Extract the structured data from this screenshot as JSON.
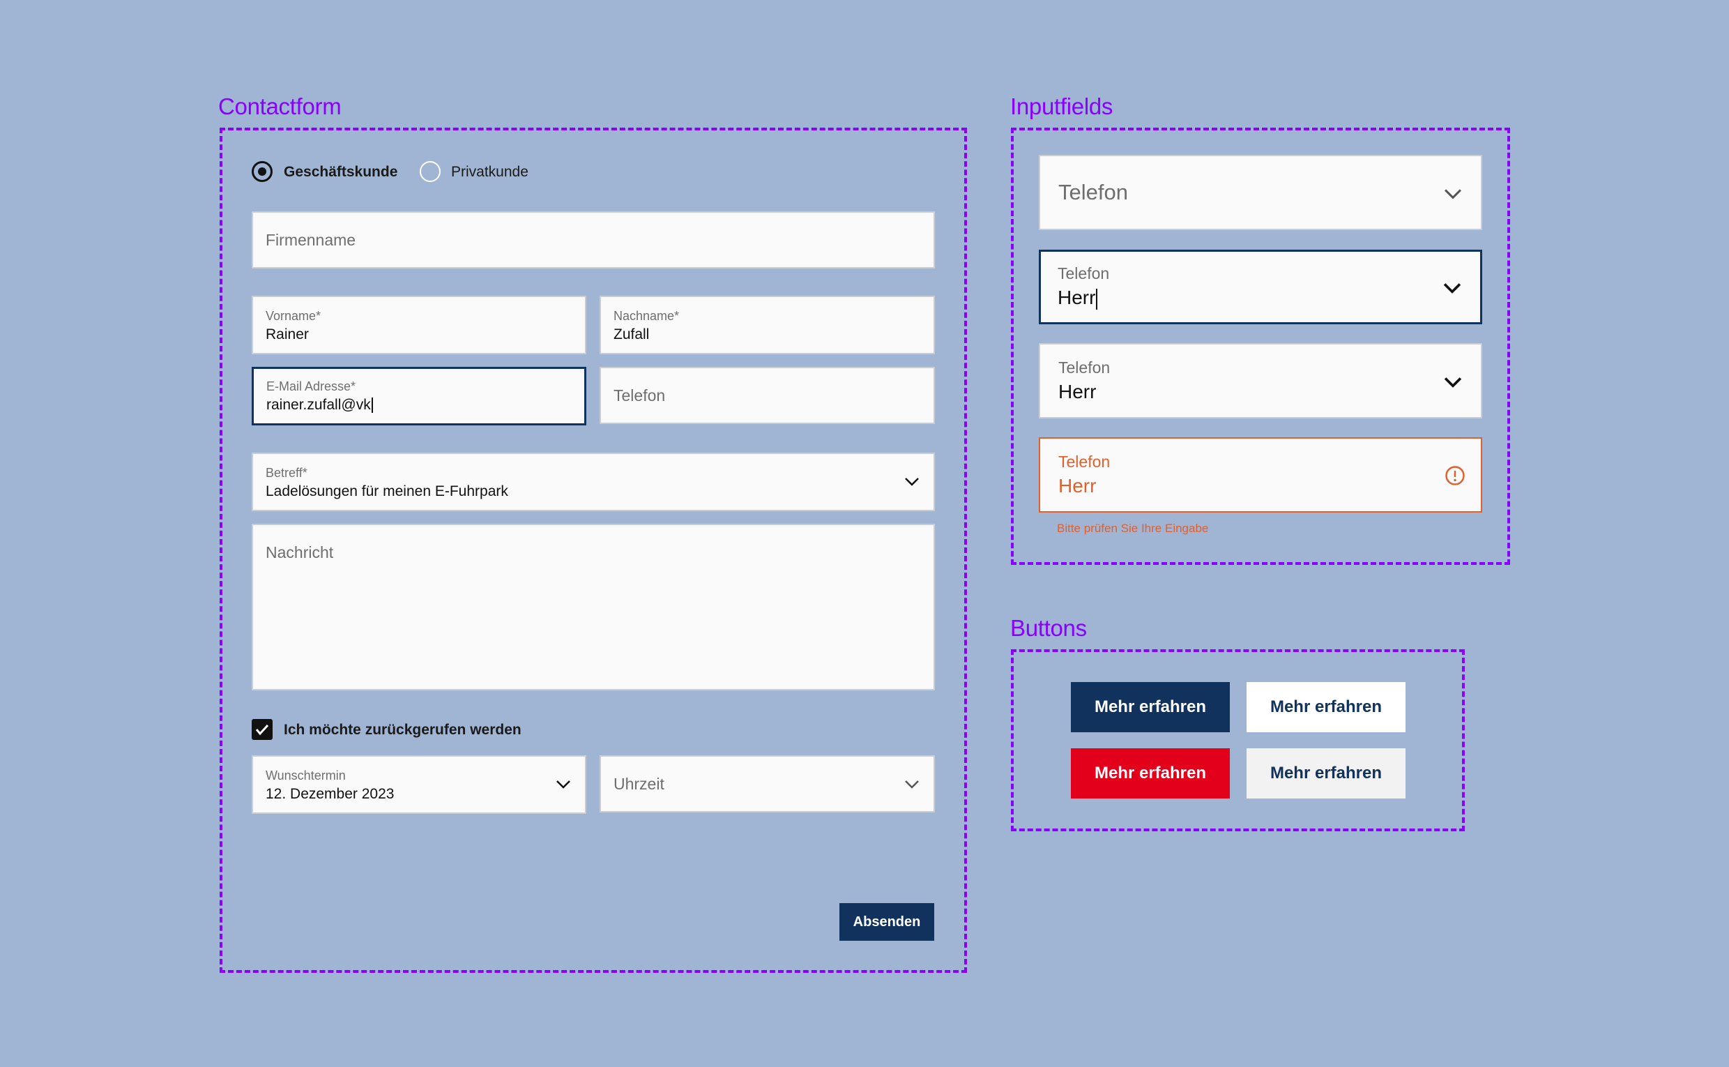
{
  "sections": {
    "contactform": "Contactform",
    "inputfields": "Inputfields",
    "buttons": "Buttons"
  },
  "form": {
    "radio_business": "Geschäftskunde",
    "radio_private": "Privatkunde",
    "company_placeholder": "Firmenname",
    "firstname_label": "Vorname*",
    "firstname_value": "Rainer",
    "lastname_label": "Nachname*",
    "lastname_value": "Zufall",
    "email_label": "E-Mail Adresse*",
    "email_value": "rainer.zufall@vk",
    "phone_placeholder": "Telefon",
    "subject_label": "Betreff*",
    "subject_value": "Ladelösungen für meinen E-Fuhrpark",
    "message_placeholder": "Nachricht",
    "callback_label": "Ich möchte zurückgerufen werden",
    "date_label": "Wunschtermin",
    "date_value": "12. Dezember 2023",
    "time_placeholder": "Uhrzeit",
    "submit_label": "Absenden"
  },
  "inputfields": {
    "default_placeholder": "Telefon",
    "focus_label": "Telefon",
    "focus_value": "Herr",
    "filled_label": "Telefon",
    "filled_value": "Herr",
    "error_label": "Telefon",
    "error_value": "Herr",
    "error_message": "Bitte prüfen Sie Ihre Eingabe"
  },
  "buttons": {
    "primary": "Mehr erfahren",
    "secondary": "Mehr erfahren",
    "red": "Mehr erfahren",
    "light": "Mehr erfahren"
  },
  "colors": {
    "accent": "#8a00ff",
    "navy": "#12325e",
    "red": "#e2001a",
    "error": "#e0612e",
    "background": "#a0b4d4"
  }
}
